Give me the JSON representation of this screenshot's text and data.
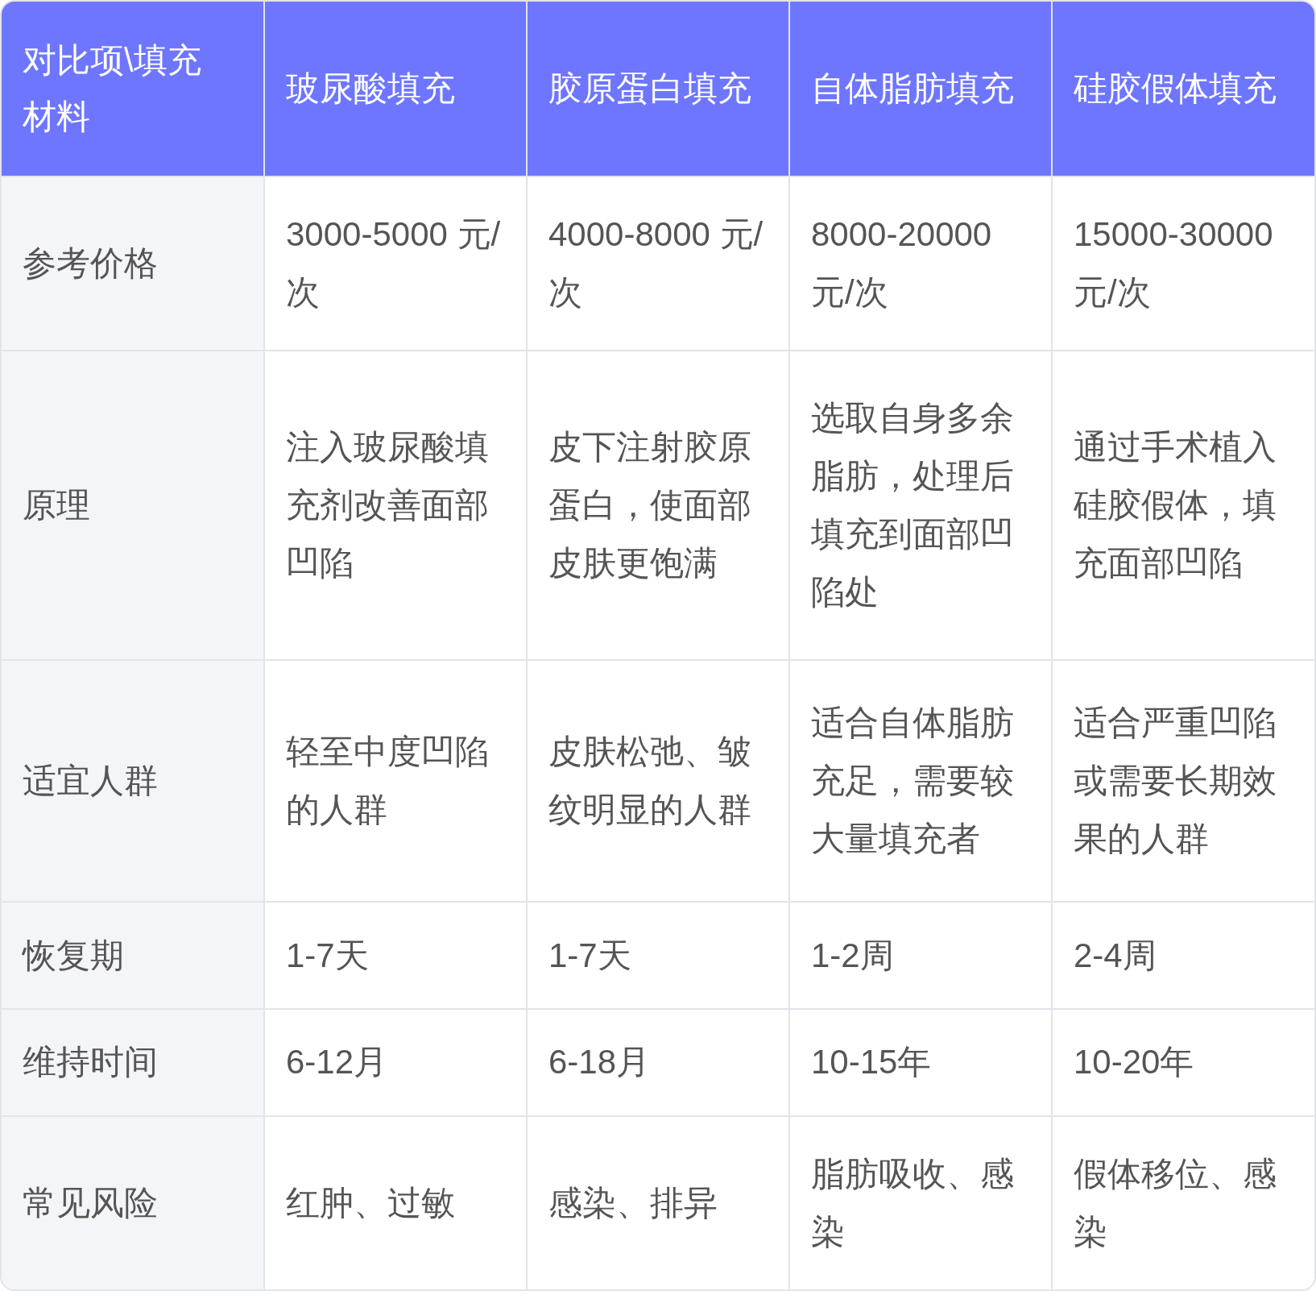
{
  "table": {
    "columns": [
      "对比项\\填充材料",
      "玻尿酸填充",
      "胶原蛋白填充",
      "自体脂肪填充",
      "硅胶假体填充"
    ],
    "rows": [
      {
        "cells": [
          "参考价格",
          "3000-5000 元/次",
          "4000-8000 元/次",
          "8000-20000 元/次",
          "15000-30000 元/次"
        ]
      },
      {
        "cells": [
          "原理",
          "注入玻尿酸填充剂改善面部凹陷",
          "皮下注射胶原蛋白，使面部皮肤更饱满",
          "选取自身多余脂肪，处理后填充到面部凹陷处",
          "通过手术植入硅胶假体，填充面部凹陷"
        ]
      },
      {
        "cells": [
          "适宜人群",
          "轻至中度凹陷的人群",
          "皮肤松弛、皱纹明显的人群",
          "适合自体脂肪充足，需要较大量填充者",
          "适合严重凹陷或需要长期效果的人群"
        ]
      },
      {
        "cells": [
          "恢复期",
          "1-7天",
          "1-7天",
          "1-2周",
          "2-4周"
        ]
      },
      {
        "cells": [
          "维持时间",
          "6-12月",
          "6-18月",
          "10-15年",
          "10-20年"
        ]
      },
      {
        "cells": [
          "常见风险",
          "红肿、过敏",
          "感染、排异",
          "脂肪吸收、感染",
          "假体移位、感染"
        ]
      }
    ]
  }
}
